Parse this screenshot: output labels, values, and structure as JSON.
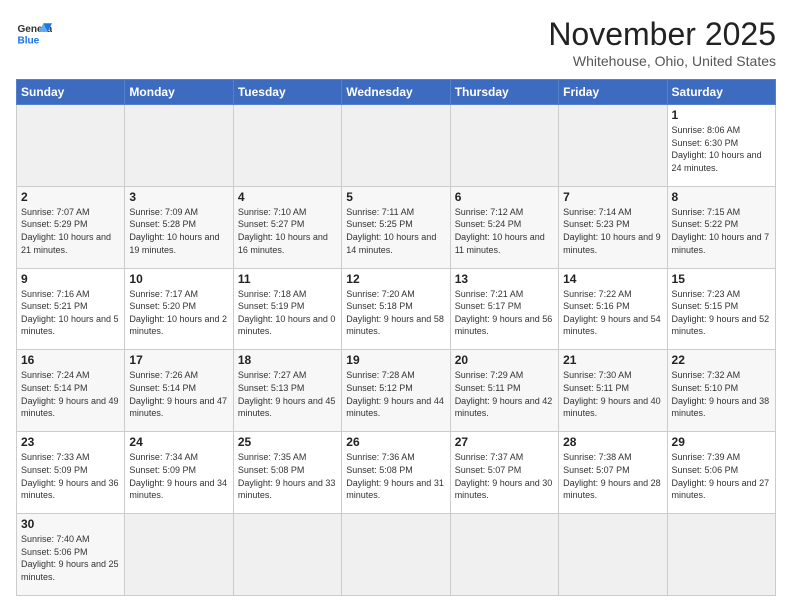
{
  "header": {
    "logo_general": "General",
    "logo_blue": "Blue",
    "month_title": "November 2025",
    "location": "Whitehouse, Ohio, United States"
  },
  "weekdays": [
    "Sunday",
    "Monday",
    "Tuesday",
    "Wednesday",
    "Thursday",
    "Friday",
    "Saturday"
  ],
  "weeks": [
    [
      {
        "day": "",
        "info": ""
      },
      {
        "day": "",
        "info": ""
      },
      {
        "day": "",
        "info": ""
      },
      {
        "day": "",
        "info": ""
      },
      {
        "day": "",
        "info": ""
      },
      {
        "day": "",
        "info": ""
      },
      {
        "day": "1",
        "info": "Sunrise: 8:06 AM\nSunset: 6:30 PM\nDaylight: 10 hours and 24 minutes."
      }
    ],
    [
      {
        "day": "2",
        "info": "Sunrise: 7:07 AM\nSunset: 5:29 PM\nDaylight: 10 hours and 21 minutes."
      },
      {
        "day": "3",
        "info": "Sunrise: 7:09 AM\nSunset: 5:28 PM\nDaylight: 10 hours and 19 minutes."
      },
      {
        "day": "4",
        "info": "Sunrise: 7:10 AM\nSunset: 5:27 PM\nDaylight: 10 hours and 16 minutes."
      },
      {
        "day": "5",
        "info": "Sunrise: 7:11 AM\nSunset: 5:25 PM\nDaylight: 10 hours and 14 minutes."
      },
      {
        "day": "6",
        "info": "Sunrise: 7:12 AM\nSunset: 5:24 PM\nDaylight: 10 hours and 11 minutes."
      },
      {
        "day": "7",
        "info": "Sunrise: 7:14 AM\nSunset: 5:23 PM\nDaylight: 10 hours and 9 minutes."
      },
      {
        "day": "8",
        "info": "Sunrise: 7:15 AM\nSunset: 5:22 PM\nDaylight: 10 hours and 7 minutes."
      }
    ],
    [
      {
        "day": "9",
        "info": "Sunrise: 7:16 AM\nSunset: 5:21 PM\nDaylight: 10 hours and 5 minutes."
      },
      {
        "day": "10",
        "info": "Sunrise: 7:17 AM\nSunset: 5:20 PM\nDaylight: 10 hours and 2 minutes."
      },
      {
        "day": "11",
        "info": "Sunrise: 7:18 AM\nSunset: 5:19 PM\nDaylight: 10 hours and 0 minutes."
      },
      {
        "day": "12",
        "info": "Sunrise: 7:20 AM\nSunset: 5:18 PM\nDaylight: 9 hours and 58 minutes."
      },
      {
        "day": "13",
        "info": "Sunrise: 7:21 AM\nSunset: 5:17 PM\nDaylight: 9 hours and 56 minutes."
      },
      {
        "day": "14",
        "info": "Sunrise: 7:22 AM\nSunset: 5:16 PM\nDaylight: 9 hours and 54 minutes."
      },
      {
        "day": "15",
        "info": "Sunrise: 7:23 AM\nSunset: 5:15 PM\nDaylight: 9 hours and 52 minutes."
      }
    ],
    [
      {
        "day": "16",
        "info": "Sunrise: 7:24 AM\nSunset: 5:14 PM\nDaylight: 9 hours and 49 minutes."
      },
      {
        "day": "17",
        "info": "Sunrise: 7:26 AM\nSunset: 5:14 PM\nDaylight: 9 hours and 47 minutes."
      },
      {
        "day": "18",
        "info": "Sunrise: 7:27 AM\nSunset: 5:13 PM\nDaylight: 9 hours and 45 minutes."
      },
      {
        "day": "19",
        "info": "Sunrise: 7:28 AM\nSunset: 5:12 PM\nDaylight: 9 hours and 44 minutes."
      },
      {
        "day": "20",
        "info": "Sunrise: 7:29 AM\nSunset: 5:11 PM\nDaylight: 9 hours and 42 minutes."
      },
      {
        "day": "21",
        "info": "Sunrise: 7:30 AM\nSunset: 5:11 PM\nDaylight: 9 hours and 40 minutes."
      },
      {
        "day": "22",
        "info": "Sunrise: 7:32 AM\nSunset: 5:10 PM\nDaylight: 9 hours and 38 minutes."
      }
    ],
    [
      {
        "day": "23",
        "info": "Sunrise: 7:33 AM\nSunset: 5:09 PM\nDaylight: 9 hours and 36 minutes."
      },
      {
        "day": "24",
        "info": "Sunrise: 7:34 AM\nSunset: 5:09 PM\nDaylight: 9 hours and 34 minutes."
      },
      {
        "day": "25",
        "info": "Sunrise: 7:35 AM\nSunset: 5:08 PM\nDaylight: 9 hours and 33 minutes."
      },
      {
        "day": "26",
        "info": "Sunrise: 7:36 AM\nSunset: 5:08 PM\nDaylight: 9 hours and 31 minutes."
      },
      {
        "day": "27",
        "info": "Sunrise: 7:37 AM\nSunset: 5:07 PM\nDaylight: 9 hours and 30 minutes."
      },
      {
        "day": "28",
        "info": "Sunrise: 7:38 AM\nSunset: 5:07 PM\nDaylight: 9 hours and 28 minutes."
      },
      {
        "day": "29",
        "info": "Sunrise: 7:39 AM\nSunset: 5:06 PM\nDaylight: 9 hours and 27 minutes."
      }
    ],
    [
      {
        "day": "30",
        "info": "Sunrise: 7:40 AM\nSunset: 5:06 PM\nDaylight: 9 hours and 25 minutes."
      },
      {
        "day": "",
        "info": ""
      },
      {
        "day": "",
        "info": ""
      },
      {
        "day": "",
        "info": ""
      },
      {
        "day": "",
        "info": ""
      },
      {
        "day": "",
        "info": ""
      },
      {
        "day": "",
        "info": ""
      }
    ]
  ]
}
